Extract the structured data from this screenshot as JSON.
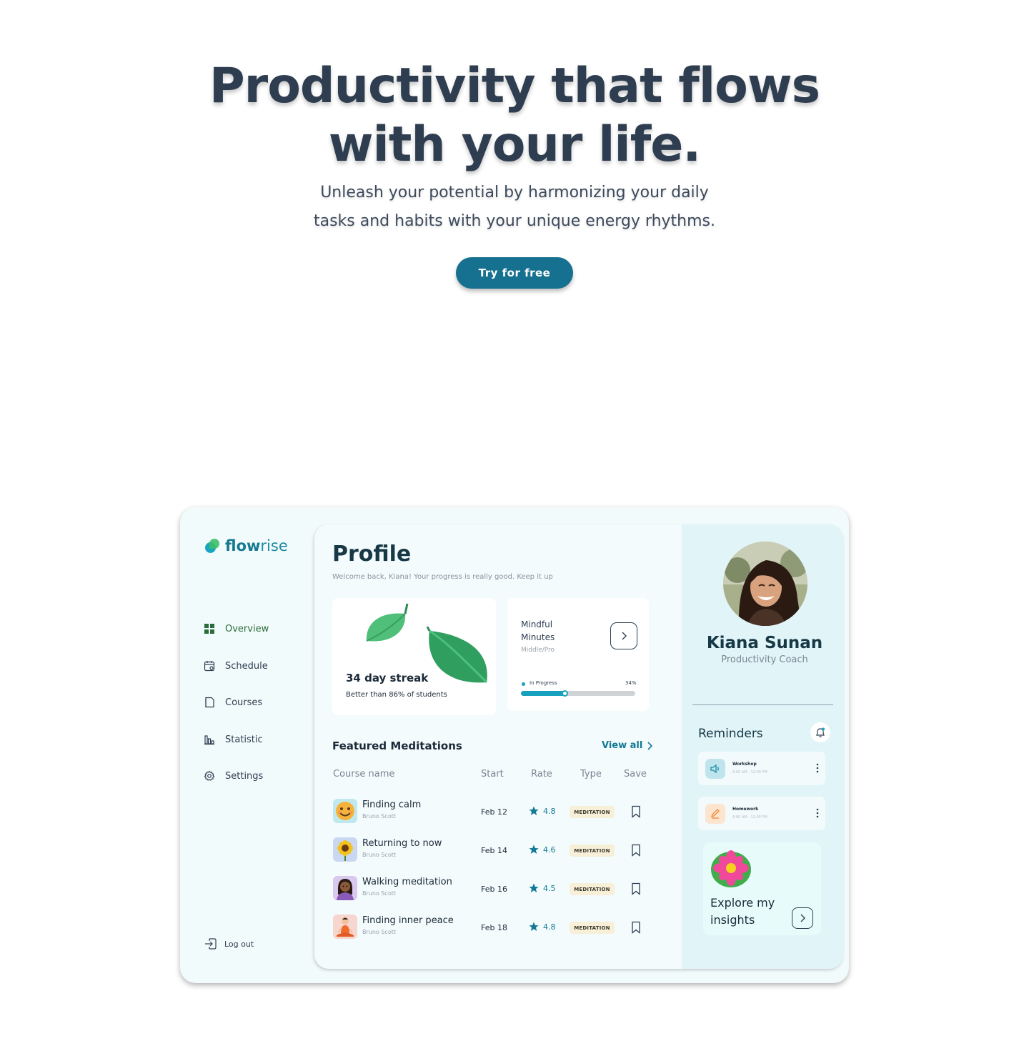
{
  "hero": {
    "title_line1": "Productivity that flows",
    "title_line2": "with your life.",
    "subtitle_line1": "Unleash your potential by harmonizing your daily",
    "subtitle_line2": "tasks and habits with your unique energy rhythms.",
    "cta_label": "Try for free",
    "cta_color": "#16708f"
  },
  "sidebar": {
    "logo_bold": "flow",
    "logo_light": "rise",
    "items": [
      {
        "label": "Overview",
        "icon": "grid-icon",
        "active": true
      },
      {
        "label": "Schedule",
        "icon": "calendar-icon",
        "active": false
      },
      {
        "label": "Courses",
        "icon": "book-icon",
        "active": false
      },
      {
        "label": "Statistic",
        "icon": "bar-chart-icon",
        "active": false
      },
      {
        "label": "Settings",
        "icon": "gear-icon",
        "active": false
      }
    ],
    "logout_label": "Log out"
  },
  "main": {
    "title": "Profile",
    "welcome": "Welcome back, Kiana! Your progress is really good. Keep it up",
    "streak": {
      "title": "34 day streak",
      "subtitle": "Better than 86% of students"
    },
    "mindful": {
      "title": "Mindful Minutes",
      "level": "Middle/Pro",
      "status": "In Progress",
      "percent_label": "34%",
      "progress": 0.38
    },
    "featured": {
      "title": "Featured Meditations",
      "view_all": "View all",
      "columns": {
        "course": "Course name",
        "start": "Start",
        "rate": "Rate",
        "type": "Type",
        "save": "Save"
      },
      "rows": [
        {
          "name": "Finding calm",
          "author": "Bruno Scott",
          "start": "Feb 12",
          "rate": "4.8",
          "type": "MEDITATION",
          "thumb": "smiley-face-icon"
        },
        {
          "name": "Returning to now",
          "author": "Bruno Scott",
          "start": "Feb 14",
          "rate": "4.6",
          "type": "MEDITATION",
          "thumb": "sunflower-icon"
        },
        {
          "name": "Walking meditation",
          "author": "Bruno Scott",
          "start": "Feb 16",
          "rate": "4.5",
          "type": "MEDITATION",
          "thumb": "woman-avatar-icon"
        },
        {
          "name": "Finding inner peace",
          "author": "Bruno Scott",
          "start": "Feb 18",
          "rate": "4.8",
          "type": "MEDITATION",
          "thumb": "meditating-person-icon"
        }
      ]
    }
  },
  "profile_panel": {
    "name": "Kiana Sunan",
    "role": "Productivity Coach",
    "reminders_title": "Reminders",
    "reminders": [
      {
        "name": "Workshop",
        "time": "8:00 AM - 12:00 PM",
        "icon": "speaker-icon"
      },
      {
        "name": "Homework",
        "time": "8:00 AM - 12:00 PM",
        "icon": "pencil-icon"
      }
    ],
    "insight_label": "Explore my insights"
  }
}
